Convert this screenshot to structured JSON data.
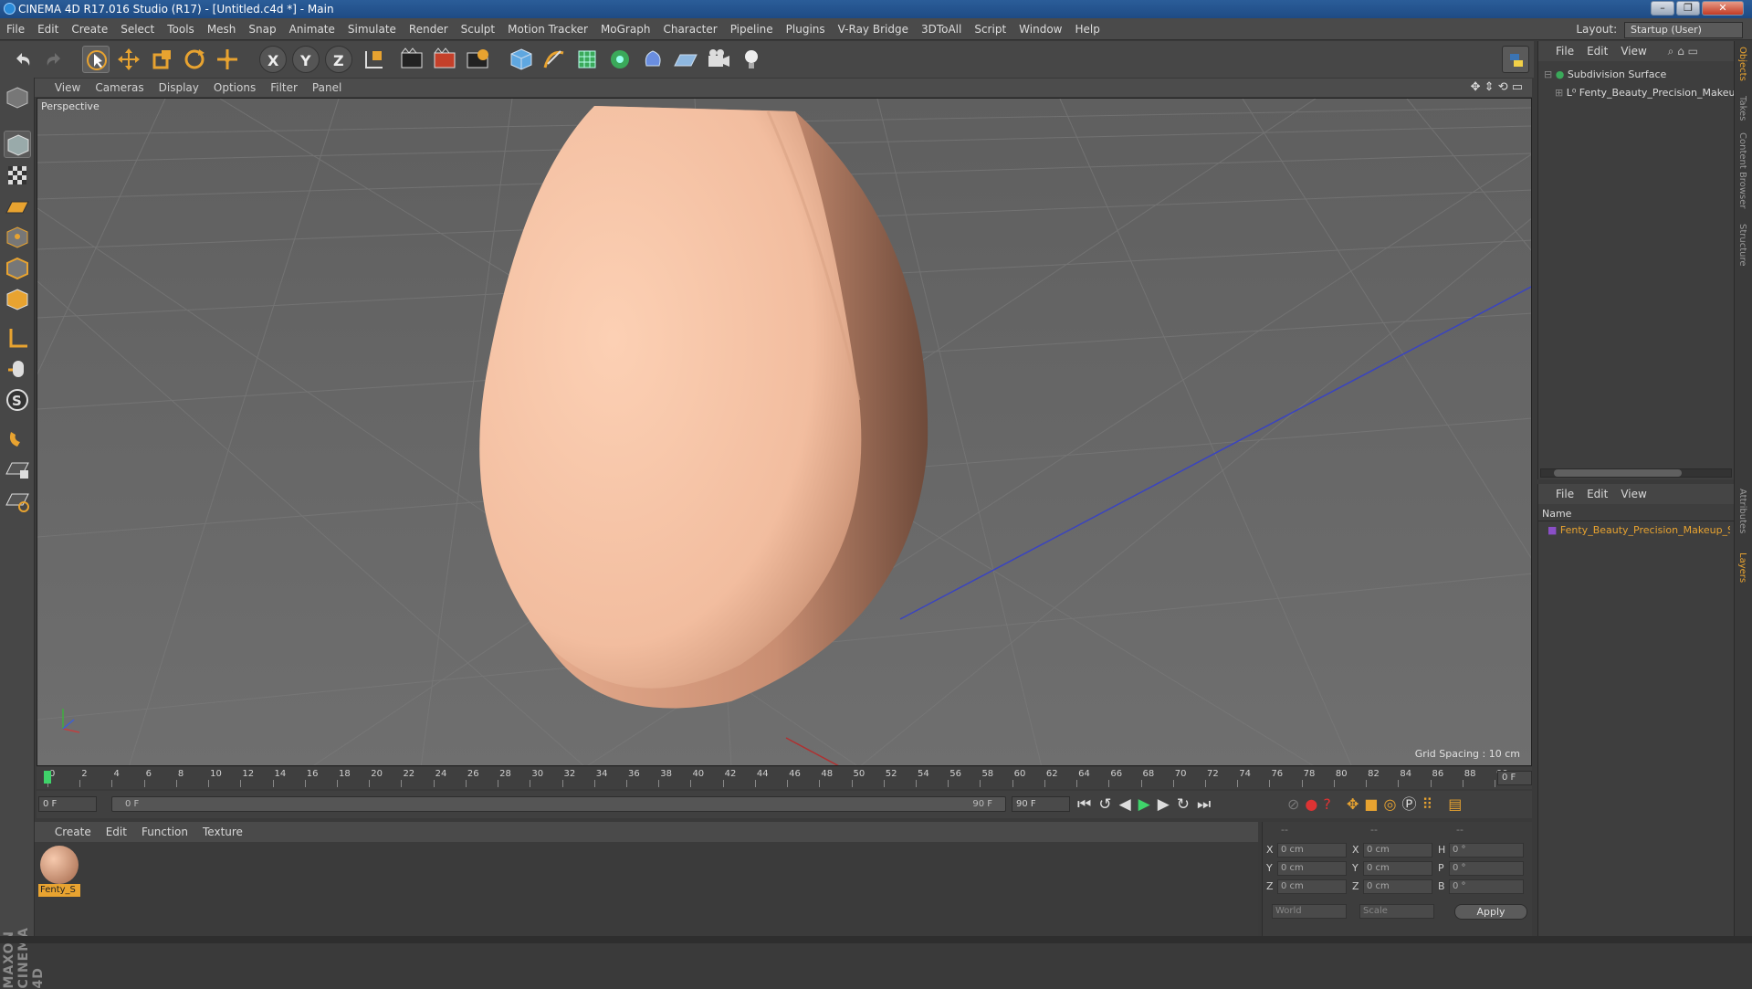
{
  "window": {
    "title": "CINEMA 4D R17.016 Studio (R17) - [Untitled.c4d *] - Main"
  },
  "menubar": [
    "File",
    "Edit",
    "Create",
    "Select",
    "Tools",
    "Mesh",
    "Snap",
    "Animate",
    "Simulate",
    "Render",
    "Sculpt",
    "Motion Tracker",
    "MoGraph",
    "Character",
    "Pipeline",
    "Plugins",
    "V-Ray Bridge",
    "3DToAll",
    "Script",
    "Window",
    "Help"
  ],
  "layout": {
    "label": "Layout:",
    "value": "Startup (User)"
  },
  "viewport": {
    "menu": [
      "View",
      "Cameras",
      "Display",
      "Options",
      "Filter",
      "Panel"
    ],
    "camera_label": "Perspective",
    "grid_spacing": "Grid Spacing : 10 cm"
  },
  "timeline": {
    "ticks": [
      "0",
      "2",
      "4",
      "6",
      "8",
      "10",
      "12",
      "14",
      "16",
      "18",
      "20",
      "22",
      "24",
      "26",
      "28",
      "30",
      "32",
      "34",
      "36",
      "38",
      "40",
      "42",
      "44",
      "46",
      "48",
      "50",
      "52",
      "54",
      "56",
      "58",
      "60",
      "62",
      "64",
      "66",
      "68",
      "70",
      "72",
      "74",
      "76",
      "78",
      "80",
      "82",
      "84",
      "86",
      "88",
      "90"
    ],
    "current_frame": "0 F",
    "start_field": "0 F",
    "range_start": "0 F",
    "range_end": "90 F",
    "end_field": "90 F"
  },
  "material_manager": {
    "menu": [
      "Create",
      "Edit",
      "Function",
      "Texture"
    ],
    "materials": [
      {
        "name": "Fenty_S"
      }
    ]
  },
  "coordinates": {
    "header": [
      "--",
      "--",
      "--"
    ],
    "rows": [
      {
        "a": "X",
        "av": "0 cm",
        "b": "X",
        "bv": "0 cm",
        "c": "H",
        "cv": "0 °"
      },
      {
        "a": "Y",
        "av": "0 cm",
        "b": "Y",
        "bv": "0 cm",
        "c": "P",
        "cv": "0 °"
      },
      {
        "a": "Z",
        "av": "0 cm",
        "b": "Z",
        "bv": "0 cm",
        "c": "B",
        "cv": "0 °"
      }
    ],
    "mode1": "World",
    "mode2": "Scale",
    "apply": "Apply"
  },
  "object_manager": {
    "menu": [
      "File",
      "Edit",
      "View"
    ],
    "objects": [
      "Subdivision Surface",
      "Fenty_Beauty_Precision_Makeup"
    ]
  },
  "attribute_manager": {
    "menu": [
      "File",
      "Edit",
      "View"
    ],
    "column": "Name",
    "layers": [
      "Fenty_Beauty_Precision_Makeup_S"
    ]
  },
  "side_tabs": [
    "Objects",
    "Takes",
    "Content Browser",
    "Structure",
    "Attributes",
    "Layers"
  ],
  "brand": "MAXON CINEMA 4D"
}
